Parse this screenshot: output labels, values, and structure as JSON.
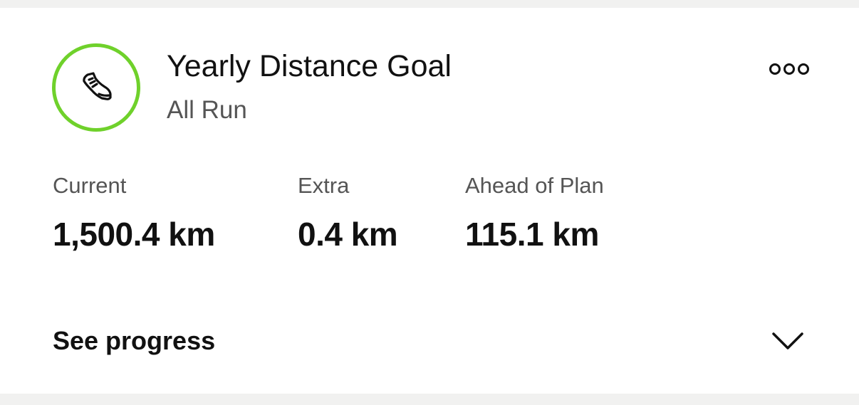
{
  "goal": {
    "title": "Yearly Distance Goal",
    "subtitle": "All Run",
    "icon": "running-shoe-icon",
    "ring_color": "#6fd12b"
  },
  "menu": {
    "icon": "more-options-icon"
  },
  "stats": [
    {
      "label": "Current",
      "value": "1,500.4 km"
    },
    {
      "label": "Extra",
      "value": "0.4 km"
    },
    {
      "label": "Ahead of Plan",
      "value": "115.1 km"
    }
  ],
  "progress": {
    "label": "See progress",
    "icon": "chevron-down-icon"
  }
}
